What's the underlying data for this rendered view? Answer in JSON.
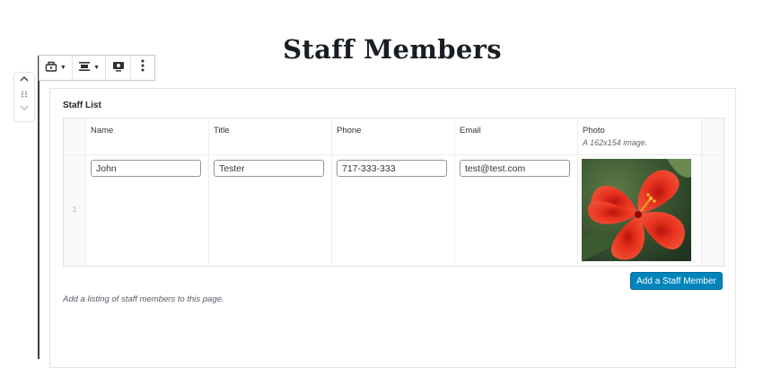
{
  "page": {
    "title": "Staff Members"
  },
  "toolbar": {
    "items": [
      {
        "icon": "block-type-icon",
        "has_dropdown": true
      },
      {
        "icon": "align-center-icon",
        "has_dropdown": true
      },
      {
        "icon": "preview-icon",
        "has_dropdown": false
      },
      {
        "icon": "more-options-icon",
        "has_dropdown": false
      }
    ]
  },
  "mover": {
    "up_icon": "chevron-up-icon",
    "drag_icon": "drag-handle-icon",
    "down_icon": "chevron-down-icon"
  },
  "block": {
    "label": "Staff List",
    "columns": [
      {
        "label": "Name"
      },
      {
        "label": "Title"
      },
      {
        "label": "Phone"
      },
      {
        "label": "Email"
      },
      {
        "label": "Photo",
        "sublabel": "A 162x154 image."
      }
    ],
    "rows": [
      {
        "index": "1",
        "name": "John",
        "title": "Tester",
        "phone": "717-333-333",
        "email": "test@test.com",
        "photo": "red hibiscus flower"
      }
    ],
    "add_button_label": "Add a Staff Member",
    "help_text": "Add a listing of staff members to this page."
  },
  "colors": {
    "primary_button": "#0085ba",
    "title": "#191e23"
  }
}
